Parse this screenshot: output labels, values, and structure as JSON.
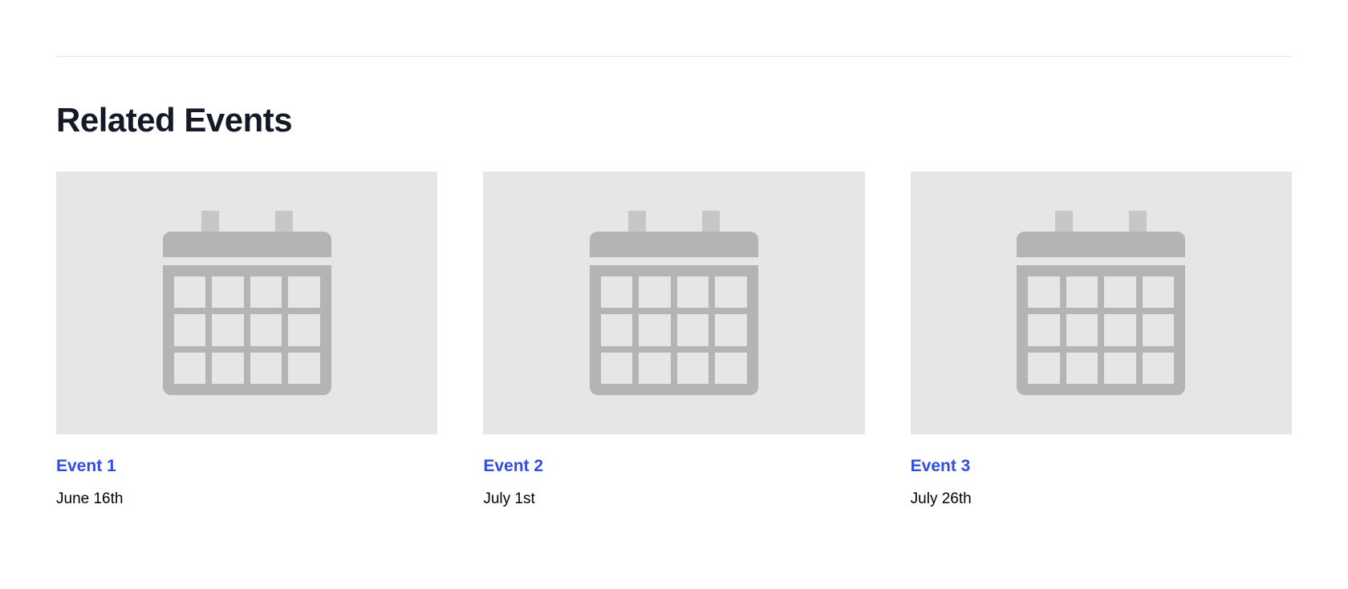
{
  "section": {
    "title": "Related Events"
  },
  "events": [
    {
      "title": "Event 1",
      "date": "June 16th"
    },
    {
      "title": "Event 2",
      "date": "July 1st"
    },
    {
      "title": "Event 3",
      "date": "July 26th"
    }
  ]
}
